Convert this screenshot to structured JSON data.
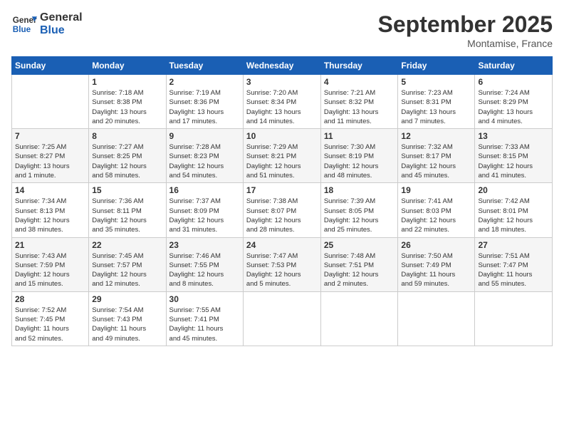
{
  "logo": {
    "line1": "General",
    "line2": "Blue"
  },
  "title": "September 2025",
  "location": "Montamise, France",
  "weekdays": [
    "Sunday",
    "Monday",
    "Tuesday",
    "Wednesday",
    "Thursday",
    "Friday",
    "Saturday"
  ],
  "weeks": [
    [
      {
        "day": "",
        "info": ""
      },
      {
        "day": "1",
        "info": "Sunrise: 7:18 AM\nSunset: 8:38 PM\nDaylight: 13 hours\nand 20 minutes."
      },
      {
        "day": "2",
        "info": "Sunrise: 7:19 AM\nSunset: 8:36 PM\nDaylight: 13 hours\nand 17 minutes."
      },
      {
        "day": "3",
        "info": "Sunrise: 7:20 AM\nSunset: 8:34 PM\nDaylight: 13 hours\nand 14 minutes."
      },
      {
        "day": "4",
        "info": "Sunrise: 7:21 AM\nSunset: 8:32 PM\nDaylight: 13 hours\nand 11 minutes."
      },
      {
        "day": "5",
        "info": "Sunrise: 7:23 AM\nSunset: 8:31 PM\nDaylight: 13 hours\nand 7 minutes."
      },
      {
        "day": "6",
        "info": "Sunrise: 7:24 AM\nSunset: 8:29 PM\nDaylight: 13 hours\nand 4 minutes."
      }
    ],
    [
      {
        "day": "7",
        "info": "Sunrise: 7:25 AM\nSunset: 8:27 PM\nDaylight: 13 hours\nand 1 minute."
      },
      {
        "day": "8",
        "info": "Sunrise: 7:27 AM\nSunset: 8:25 PM\nDaylight: 12 hours\nand 58 minutes."
      },
      {
        "day": "9",
        "info": "Sunrise: 7:28 AM\nSunset: 8:23 PM\nDaylight: 12 hours\nand 54 minutes."
      },
      {
        "day": "10",
        "info": "Sunrise: 7:29 AM\nSunset: 8:21 PM\nDaylight: 12 hours\nand 51 minutes."
      },
      {
        "day": "11",
        "info": "Sunrise: 7:30 AM\nSunset: 8:19 PM\nDaylight: 12 hours\nand 48 minutes."
      },
      {
        "day": "12",
        "info": "Sunrise: 7:32 AM\nSunset: 8:17 PM\nDaylight: 12 hours\nand 45 minutes."
      },
      {
        "day": "13",
        "info": "Sunrise: 7:33 AM\nSunset: 8:15 PM\nDaylight: 12 hours\nand 41 minutes."
      }
    ],
    [
      {
        "day": "14",
        "info": "Sunrise: 7:34 AM\nSunset: 8:13 PM\nDaylight: 12 hours\nand 38 minutes."
      },
      {
        "day": "15",
        "info": "Sunrise: 7:36 AM\nSunset: 8:11 PM\nDaylight: 12 hours\nand 35 minutes."
      },
      {
        "day": "16",
        "info": "Sunrise: 7:37 AM\nSunset: 8:09 PM\nDaylight: 12 hours\nand 31 minutes."
      },
      {
        "day": "17",
        "info": "Sunrise: 7:38 AM\nSunset: 8:07 PM\nDaylight: 12 hours\nand 28 minutes."
      },
      {
        "day": "18",
        "info": "Sunrise: 7:39 AM\nSunset: 8:05 PM\nDaylight: 12 hours\nand 25 minutes."
      },
      {
        "day": "19",
        "info": "Sunrise: 7:41 AM\nSunset: 8:03 PM\nDaylight: 12 hours\nand 22 minutes."
      },
      {
        "day": "20",
        "info": "Sunrise: 7:42 AM\nSunset: 8:01 PM\nDaylight: 12 hours\nand 18 minutes."
      }
    ],
    [
      {
        "day": "21",
        "info": "Sunrise: 7:43 AM\nSunset: 7:59 PM\nDaylight: 12 hours\nand 15 minutes."
      },
      {
        "day": "22",
        "info": "Sunrise: 7:45 AM\nSunset: 7:57 PM\nDaylight: 12 hours\nand 12 minutes."
      },
      {
        "day": "23",
        "info": "Sunrise: 7:46 AM\nSunset: 7:55 PM\nDaylight: 12 hours\nand 8 minutes."
      },
      {
        "day": "24",
        "info": "Sunrise: 7:47 AM\nSunset: 7:53 PM\nDaylight: 12 hours\nand 5 minutes."
      },
      {
        "day": "25",
        "info": "Sunrise: 7:48 AM\nSunset: 7:51 PM\nDaylight: 12 hours\nand 2 minutes."
      },
      {
        "day": "26",
        "info": "Sunrise: 7:50 AM\nSunset: 7:49 PM\nDaylight: 11 hours\nand 59 minutes."
      },
      {
        "day": "27",
        "info": "Sunrise: 7:51 AM\nSunset: 7:47 PM\nDaylight: 11 hours\nand 55 minutes."
      }
    ],
    [
      {
        "day": "28",
        "info": "Sunrise: 7:52 AM\nSunset: 7:45 PM\nDaylight: 11 hours\nand 52 minutes."
      },
      {
        "day": "29",
        "info": "Sunrise: 7:54 AM\nSunset: 7:43 PM\nDaylight: 11 hours\nand 49 minutes."
      },
      {
        "day": "30",
        "info": "Sunrise: 7:55 AM\nSunset: 7:41 PM\nDaylight: 11 hours\nand 45 minutes."
      },
      {
        "day": "",
        "info": ""
      },
      {
        "day": "",
        "info": ""
      },
      {
        "day": "",
        "info": ""
      },
      {
        "day": "",
        "info": ""
      }
    ]
  ]
}
